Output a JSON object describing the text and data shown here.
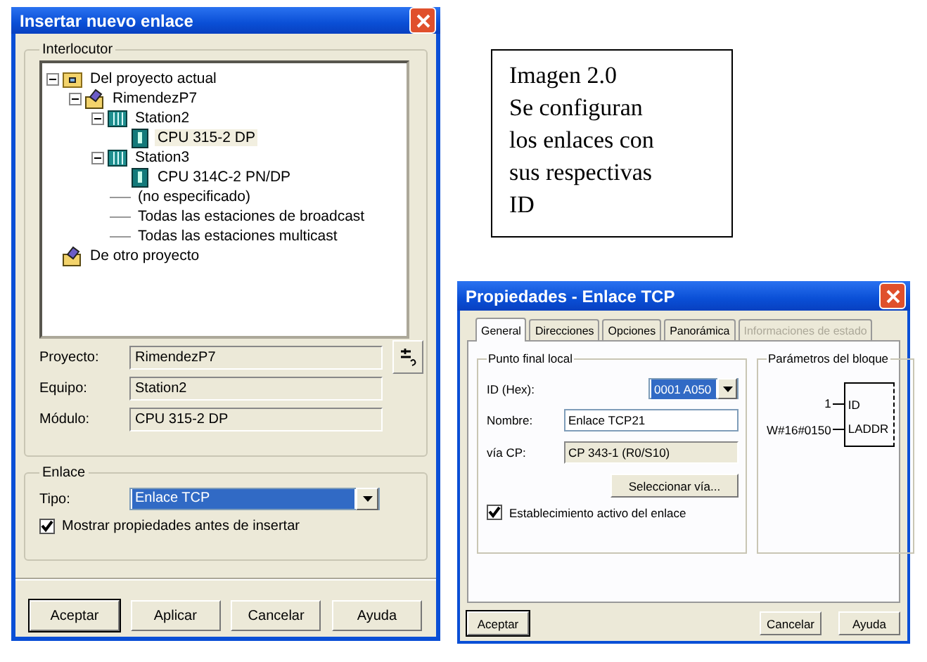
{
  "insert_dialog": {
    "title": "Insertar nuevo enlace",
    "partner_group": {
      "title": "Interlocutor",
      "tree": [
        {
          "label": "Del proyecto actual",
          "kind": "folder",
          "expanded": true,
          "selected": false,
          "children": [
            {
              "label": "RimendezP7",
              "kind": "project",
              "expanded": true,
              "selected": false,
              "children": [
                {
                  "label": "Station2",
                  "kind": "station",
                  "expanded": true,
                  "selected": false,
                  "children": [
                    {
                      "label": "CPU 315-2 DP",
                      "kind": "cpu",
                      "selected": true
                    }
                  ]
                },
                {
                  "label": "Station3",
                  "kind": "station",
                  "expanded": true,
                  "selected": false,
                  "children": [
                    {
                      "label": "CPU 314C-2 PN/DP",
                      "kind": "cpu",
                      "selected": false
                    }
                  ]
                },
                {
                  "label": "(no especificado)",
                  "kind": "line",
                  "selected": false
                },
                {
                  "label": "Todas las estaciones de broadcast",
                  "kind": "line",
                  "selected": false
                },
                {
                  "label": "Todas las estaciones multicast",
                  "kind": "line",
                  "selected": false
                }
              ]
            }
          ]
        },
        {
          "label": "De otro proyecto",
          "kind": "project",
          "selected": false
        }
      ],
      "fields": [
        {
          "label": "Proyecto:",
          "value": "RimendezP7"
        },
        {
          "label": "Equipo:",
          "value": "Station2"
        },
        {
          "label": "Módulo:",
          "value": "CPU 315-2 DP"
        }
      ]
    },
    "link_group": {
      "title": "Enlace",
      "type_label": "Tipo:",
      "type_value": "Enlace TCP",
      "type_highlighted": true,
      "show_properties": {
        "label": "Mostrar propiedades antes de insertar",
        "checked": true
      }
    },
    "buttons": [
      {
        "label": "Aceptar",
        "default": true
      },
      {
        "label": "Aplicar",
        "default": false
      },
      {
        "label": "Cancelar",
        "default": false
      },
      {
        "label": "Ayuda",
        "default": false
      }
    ]
  },
  "caption": {
    "lines": [
      "Imagen 2.0",
      "Se configuran",
      "los enlaces con",
      "sus respectivas",
      "ID"
    ]
  },
  "properties_dialog": {
    "title": "Propiedades - Enlace TCP",
    "tabs": [
      {
        "label": "General",
        "selected": true,
        "disabled": false
      },
      {
        "label": "Direcciones",
        "selected": false,
        "disabled": false
      },
      {
        "label": "Opciones",
        "selected": false,
        "disabled": false
      },
      {
        "label": "Panorámica",
        "selected": false,
        "disabled": false
      },
      {
        "label": "Informaciones de estado",
        "selected": false,
        "disabled": true
      }
    ],
    "local_endpoint": {
      "title": "Punto final local",
      "id": {
        "label": "ID (Hex):",
        "value": "0001 A050",
        "highlighted": true
      },
      "name": {
        "label": "Nombre:",
        "value": "Enlace TCP21"
      },
      "via_cp": {
        "label": "vía CP:",
        "value": "CP 343-1 (R0/S10)"
      },
      "select_button": "Seleccionar vía...",
      "active": {
        "label": "Establecimiento activo del enlace",
        "checked": true
      }
    },
    "block_params": {
      "title": "Parámetros del bloque",
      "inputs": [
        {
          "value": "1",
          "pin": "ID"
        },
        {
          "value": "W#16#0150",
          "pin": "LADDR"
        }
      ]
    },
    "left_buttons": [
      {
        "label": "Aceptar",
        "default": true
      }
    ],
    "right_buttons": [
      {
        "label": "Cancelar",
        "default": false
      },
      {
        "label": "Ayuda",
        "default": false
      }
    ]
  }
}
